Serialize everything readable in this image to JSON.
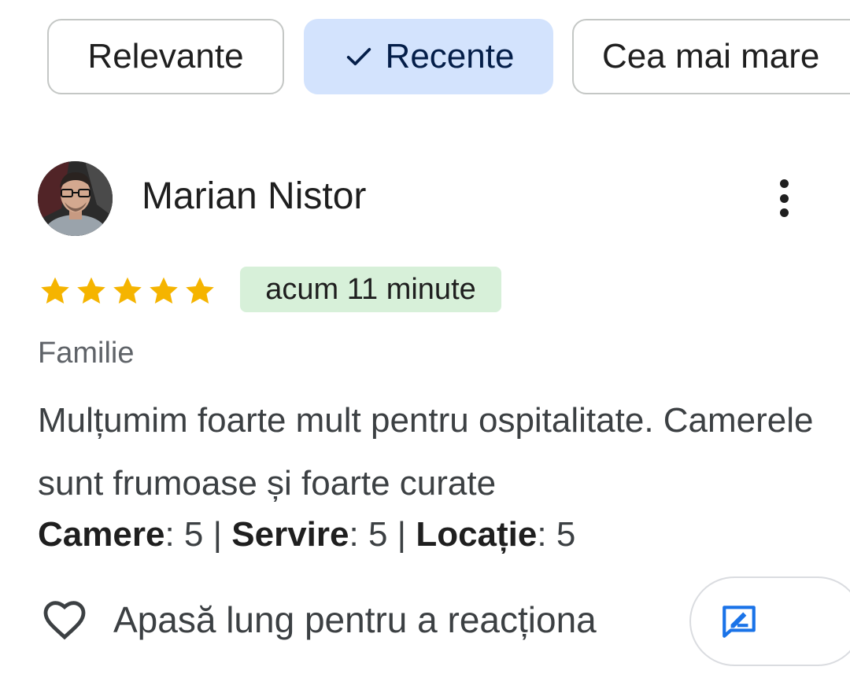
{
  "filters": {
    "relevante": "Relevante",
    "recente": "Recente",
    "cea_mai_mare": "Cea mai mare"
  },
  "review": {
    "author": "Marian Nistor",
    "rating": 5,
    "rating_max": 5,
    "time": "acum 11 minute",
    "trip_type": "Familie",
    "text": "Mulțumim foarte mult pentru ospitalitate. Camerele sunt frumoase și foarte curate",
    "sub_ratings": [
      {
        "label": "Camere",
        "value": "5"
      },
      {
        "label": "Servire",
        "value": "5"
      },
      {
        "label": "Locație",
        "value": "5"
      }
    ],
    "react_label": "Apasă lung pentru a reacționa"
  },
  "icons": {
    "check": "check-icon",
    "more": "more-vert-icon",
    "star": "star-icon",
    "heart": "heart-outline-icon",
    "reply": "reply-icon"
  },
  "colors": {
    "star": "#f5b400",
    "selected_chip": "#d3e3fd",
    "time_badge": "#d7f0d9",
    "reply_icon": "#1a73e8"
  }
}
